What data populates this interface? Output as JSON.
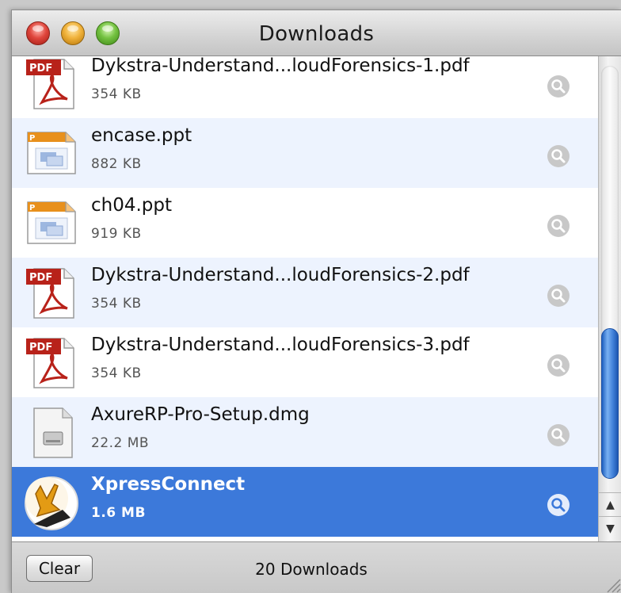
{
  "window": {
    "title": "Downloads"
  },
  "downloads": [
    {
      "name": "Dykstra-Understand...loudForensics-1.pdf",
      "size": "354 KB",
      "type": "pdf",
      "icon_label": "PDF",
      "selected": false
    },
    {
      "name": "encase.ppt",
      "size": "882 KB",
      "type": "ppt",
      "icon_label": "P",
      "selected": false
    },
    {
      "name": "ch04.ppt",
      "size": "919 KB",
      "type": "ppt",
      "icon_label": "P",
      "selected": false
    },
    {
      "name": "Dykstra-Understand...loudForensics-2.pdf",
      "size": "354 KB",
      "type": "pdf",
      "icon_label": "PDF",
      "selected": false
    },
    {
      "name": "Dykstra-Understand...loudForensics-3.pdf",
      "size": "354 KB",
      "type": "pdf",
      "icon_label": "PDF",
      "selected": false
    },
    {
      "name": "AxureRP-Pro-Setup.dmg",
      "size": "22.2 MB",
      "type": "dmg",
      "icon_label": "",
      "selected": false
    },
    {
      "name": "XpressConnect",
      "size": "1.6 MB",
      "type": "app",
      "icon_label": "",
      "selected": true
    }
  ],
  "footer": {
    "clear_label": "Clear",
    "count_text": "20 Downloads"
  },
  "icons": {
    "reveal": "magnifier-icon",
    "scroll_up": "▲",
    "scroll_down": "▼"
  },
  "colors": {
    "selection": "#3c79da",
    "alt_row": "#edf3fe",
    "pdf_red": "#b8221a",
    "ppt_orange": "#e8901c",
    "scroll_thumb": "#3f7fd8"
  }
}
